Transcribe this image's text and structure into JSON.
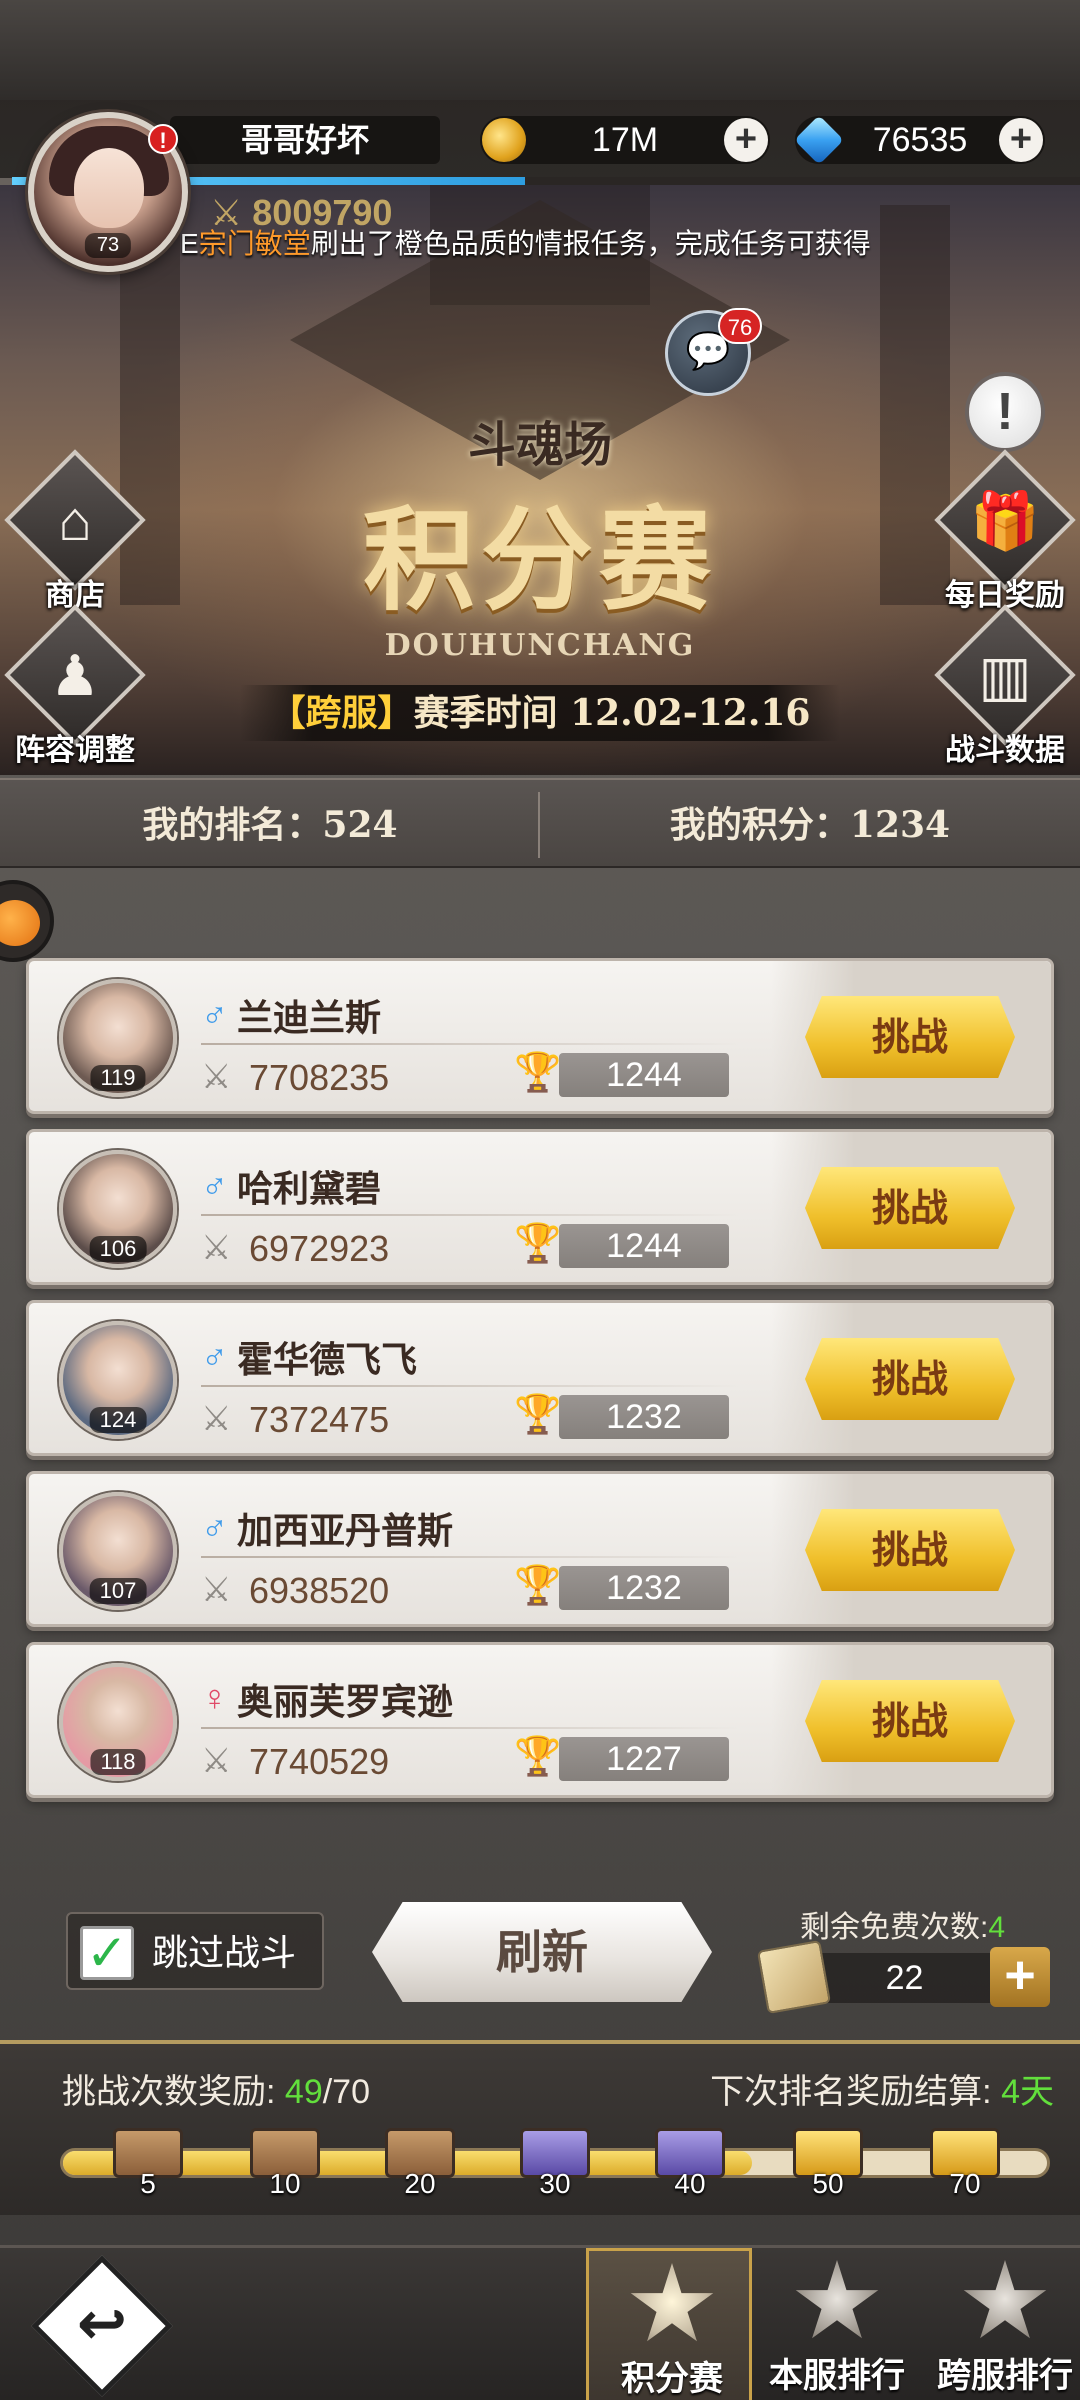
{
  "player": {
    "name": "哥哥好坏",
    "level": "73",
    "alert": "!",
    "power": "8009790",
    "exp_fraction": 0.48
  },
  "resources": {
    "gold": "17M",
    "gems": "76535"
  },
  "ticker": {
    "highlight": "宗门敏堂",
    "prefix": "E",
    "text": "刷出了橙色品质的情报任务，完成任务可获得"
  },
  "banner": {
    "subtitle": "斗魂场",
    "title": "积分赛",
    "english": "DOUHUNCHANG",
    "season_prefix": "【跨服】",
    "season_text": "赛季时间 12.02-12.16"
  },
  "chat": {
    "badge": "76"
  },
  "side_buttons": {
    "shop": "商店",
    "lineup": "阵容调整",
    "daily": "每日奖励",
    "stats": "战斗数据"
  },
  "my_rank": {
    "rank_label": "我的排名：524",
    "score_label": "我的积分：1234"
  },
  "opponents": [
    {
      "gender": "male",
      "name": "兰迪兰斯",
      "level": "119",
      "power": "7708235",
      "score": "1244",
      "button": "挑战",
      "avatar_color": "#6d5a52"
    },
    {
      "gender": "male",
      "name": "哈利黛碧",
      "level": "106",
      "power": "6972923",
      "score": "1244",
      "button": "挑战",
      "avatar_color": "#5c4d4a"
    },
    {
      "gender": "male",
      "name": "霍华德飞飞",
      "level": "124",
      "power": "7372475",
      "score": "1232",
      "button": "挑战",
      "avatar_color": "#5a6880"
    },
    {
      "gender": "male",
      "name": "加西亚丹普斯",
      "level": "107",
      "power": "6938520",
      "score": "1232",
      "button": "挑战",
      "avatar_color": "#6b5a6a"
    },
    {
      "gender": "female",
      "name": "奥丽芙罗宾逊",
      "level": "118",
      "power": "7740529",
      "score": "1227",
      "button": "挑战",
      "avatar_color": "#e59aa4"
    }
  ],
  "gender_symbols": {
    "male": "♂",
    "female": "♀"
  },
  "controls": {
    "skip_battle": "跳过战斗",
    "refresh": "刷新",
    "free_label": "剩余免费次数:",
    "free_count": "4",
    "tickets": "22"
  },
  "rewards": {
    "title": "挑战次数奖励:",
    "current": "49",
    "total": "/70",
    "settle_label": "下次排名奖励结算:",
    "settle_value": "4天",
    "progress_fraction": 0.7,
    "chests": [
      {
        "count": "5",
        "kind": "wood"
      },
      {
        "count": "10",
        "kind": "wood"
      },
      {
        "count": "20",
        "kind": "wood"
      },
      {
        "count": "30",
        "kind": "purple"
      },
      {
        "count": "40",
        "kind": "purple"
      },
      {
        "count": "50",
        "kind": "gold"
      },
      {
        "count": "70",
        "kind": "gold"
      }
    ]
  },
  "nav": {
    "back_glyph": "↩",
    "tabs": [
      {
        "label": "积分赛",
        "active": true
      },
      {
        "label": "本服排行",
        "active": false
      },
      {
        "label": "跨服排行",
        "active": false
      }
    ]
  }
}
